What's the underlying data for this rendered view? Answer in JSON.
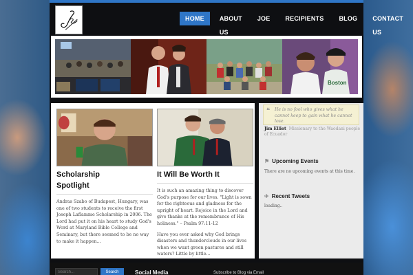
{
  "nav": {
    "items": [
      {
        "label": "HOME",
        "active": true
      },
      {
        "label": "ABOUT US"
      },
      {
        "label": "JOE"
      },
      {
        "label": "RECIPIENTS"
      },
      {
        "label": "BLOG"
      },
      {
        "label": "CONTACT US"
      }
    ]
  },
  "posts": [
    {
      "title_line1": "Scholarship",
      "title_line2": "Spotlight",
      "excerpt": "Andras Szabo of Budapest, Hungary, was one of two students to receive the first Joseph Laflamme Scholarship in 2006. The Lord had put it on his heart to study God's Word at Maryland Bible College and Seminary, but there seemed to be no way to make it happen..."
    },
    {
      "title": "It Will Be Worth It",
      "excerpt_1": "It is such an amazing thing to discover God's purpose for our lives. \"Light is sown for the righteous and gladness for the upright of heart. Rejoice in the Lord and give thanks at the remembrance of His holiness.\" – Psalm 97:11-12",
      "excerpt_2": "Have you ever asked why God brings disasters and thunderclouds in our lives when we want green pastures and still waters? Little by little..."
    }
  ],
  "sidebar": {
    "quote": "He is no fool who gives what he cannot keep to gain what he cannot lose.",
    "quote_author": "Jim Elliot",
    "quote_author_desc": "Missionary to the Waodani people of Ecuador",
    "upcoming_title": "Upcoming Events",
    "upcoming_text": "There are no upcoming events at this time.",
    "tweets_title": "Recent Tweets",
    "tweets_text": "loading.."
  },
  "footer": {
    "search_placeholder": "Search...",
    "search_button": "Search",
    "social_title": "Social Media",
    "subscribe_text": "Subscribe to Blog via Email"
  },
  "colors": {
    "accent": "#2f76c7",
    "frame": "#0e0f12",
    "quote_bg": "#f5f1d3"
  }
}
